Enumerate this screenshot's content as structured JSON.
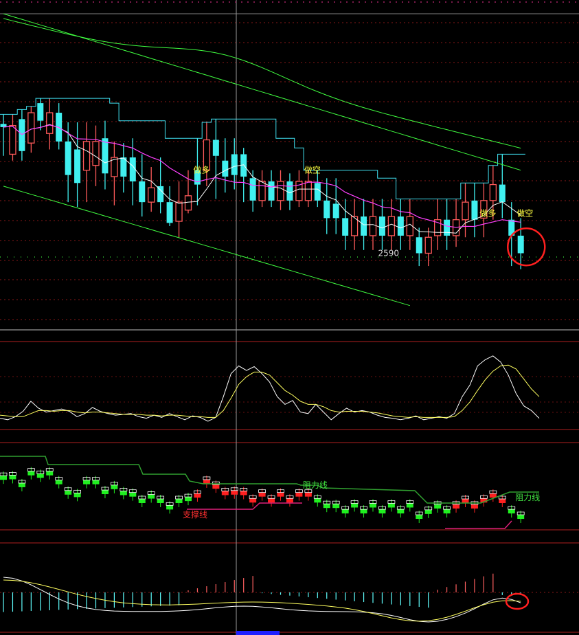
{
  "chart_data": [
    {
      "type": "candlestick",
      "panel": "main",
      "grid": true,
      "colors": {
        "up": "#ff5a5a",
        "down": "#40f0f0",
        "ma_fast": "#ffffff",
        "ma_mid": "#ff40ff",
        "ma_slow": "#40ff40",
        "channel": "#40e0f0"
      },
      "candles": [
        {
          "o": 2659,
          "c": 2657,
          "h": 2665,
          "l": 2639,
          "u": false
        },
        {
          "o": 2640,
          "c": 2658,
          "h": 2665,
          "l": 2636,
          "u": true
        },
        {
          "o": 2662,
          "c": 2642,
          "h": 2668,
          "l": 2636,
          "u": false
        },
        {
          "o": 2647,
          "c": 2666,
          "h": 2670,
          "l": 2641,
          "u": true
        },
        {
          "o": 2672,
          "c": 2661,
          "h": 2675,
          "l": 2655,
          "u": false
        },
        {
          "o": 2653,
          "c": 2666,
          "h": 2675,
          "l": 2643,
          "u": true
        },
        {
          "o": 2666,
          "c": 2648,
          "h": 2672,
          "l": 2643,
          "u": false
        },
        {
          "o": 2648,
          "c": 2627,
          "h": 2660,
          "l": 2610,
          "u": false
        },
        {
          "o": 2643,
          "c": 2622,
          "h": 2660,
          "l": 2607,
          "u": false
        },
        {
          "o": 2630,
          "c": 2648,
          "h": 2660,
          "l": 2610,
          "u": true
        },
        {
          "o": 2633,
          "c": 2648,
          "h": 2658,
          "l": 2620,
          "u": true
        },
        {
          "o": 2650,
          "c": 2628,
          "h": 2661,
          "l": 2618,
          "u": false
        },
        {
          "o": 2626,
          "c": 2638,
          "h": 2648,
          "l": 2608,
          "u": true
        },
        {
          "o": 2638,
          "c": 2626,
          "h": 2647,
          "l": 2616,
          "u": false
        },
        {
          "o": 2638,
          "c": 2623,
          "h": 2650,
          "l": 2608,
          "u": false
        },
        {
          "o": 2623,
          "c": 2610,
          "h": 2640,
          "l": 2601,
          "u": false
        },
        {
          "o": 2610,
          "c": 2619,
          "h": 2632,
          "l": 2604,
          "u": true
        },
        {
          "o": 2620,
          "c": 2610,
          "h": 2638,
          "l": 2603,
          "u": false
        },
        {
          "o": 2610,
          "c": 2597,
          "h": 2620,
          "l": 2595,
          "u": false
        },
        {
          "o": 2598,
          "c": 2610,
          "h": 2623,
          "l": 2588,
          "u": true
        },
        {
          "o": 2605,
          "c": 2614,
          "h": 2630,
          "l": 2603,
          "u": true
        },
        {
          "o": 2630,
          "c": 2621,
          "h": 2650,
          "l": 2608,
          "u": false
        },
        {
          "o": 2630,
          "c": 2649,
          "h": 2660,
          "l": 2620,
          "u": true
        },
        {
          "o": 2649,
          "c": 2639,
          "h": 2662,
          "l": 2612,
          "u": false
        },
        {
          "o": 2636,
          "c": 2626,
          "h": 2650,
          "l": 2616,
          "u": false
        },
        {
          "o": 2640,
          "c": 2627,
          "h": 2650,
          "l": 2618,
          "u": false
        },
        {
          "o": 2640,
          "c": 2626,
          "h": 2644,
          "l": 2610,
          "u": false
        },
        {
          "o": 2625,
          "c": 2611,
          "h": 2630,
          "l": 2604,
          "u": false
        },
        {
          "o": 2611,
          "c": 2623,
          "h": 2630,
          "l": 2607,
          "u": true
        },
        {
          "o": 2623,
          "c": 2611,
          "h": 2630,
          "l": 2607,
          "u": false
        },
        {
          "o": 2611,
          "c": 2623,
          "h": 2630,
          "l": 2605,
          "u": true
        },
        {
          "o": 2623,
          "c": 2611,
          "h": 2628,
          "l": 2605,
          "u": false
        },
        {
          "o": 2611,
          "c": 2623,
          "h": 2630,
          "l": 2607,
          "u": true
        },
        {
          "o": 2611,
          "c": 2623,
          "h": 2630,
          "l": 2607,
          "u": true
        },
        {
          "o": 2622,
          "c": 2611,
          "h": 2630,
          "l": 2607,
          "u": false
        },
        {
          "o": 2611,
          "c": 2600,
          "h": 2625,
          "l": 2590,
          "u": false
        },
        {
          "o": 2609,
          "c": 2600,
          "h": 2625,
          "l": 2590,
          "u": false
        },
        {
          "o": 2600,
          "c": 2589,
          "h": 2612,
          "l": 2580,
          "u": false
        },
        {
          "o": 2589,
          "c": 2601,
          "h": 2612,
          "l": 2580,
          "u": true
        },
        {
          "o": 2601,
          "c": 2589,
          "h": 2612,
          "l": 2580,
          "u": false
        },
        {
          "o": 2589,
          "c": 2601,
          "h": 2612,
          "l": 2580,
          "u": true
        },
        {
          "o": 2601,
          "c": 2589,
          "h": 2612,
          "l": 2580,
          "u": false
        },
        {
          "o": 2589,
          "c": 2601,
          "h": 2612,
          "l": 2580,
          "u": true
        },
        {
          "o": 2601,
          "c": 2589,
          "h": 2612,
          "l": 2580,
          "u": false
        },
        {
          "o": 2589,
          "c": 2601,
          "h": 2612,
          "l": 2580,
          "u": true
        },
        {
          "o": 2588,
          "c": 2578,
          "h": 2594,
          "l": 2570,
          "u": false
        },
        {
          "o": 2578,
          "c": 2588,
          "h": 2594,
          "l": 2570,
          "u": true
        },
        {
          "o": 2589,
          "c": 2599,
          "h": 2612,
          "l": 2580,
          "u": true
        },
        {
          "o": 2599,
          "c": 2589,
          "h": 2612,
          "l": 2580,
          "u": false
        },
        {
          "o": 2589,
          "c": 2599,
          "h": 2612,
          "l": 2582,
          "u": true
        },
        {
          "o": 2599,
          "c": 2610,
          "h": 2622,
          "l": 2588,
          "u": true
        },
        {
          "o": 2611,
          "c": 2599,
          "h": 2622,
          "l": 2588,
          "u": false
        },
        {
          "o": 2600,
          "c": 2611,
          "h": 2622,
          "l": 2588,
          "u": true
        },
        {
          "o": 2611,
          "c": 2621,
          "h": 2633,
          "l": 2599,
          "u": true
        },
        {
          "o": 2621,
          "c": 2610,
          "h": 2640,
          "l": 2600,
          "u": false
        },
        {
          "o": 2599,
          "c": 2589,
          "h": 2610,
          "l": 2570,
          "u": false
        },
        {
          "o": 2589,
          "c": 2578,
          "h": 2600,
          "l": 2568,
          "u": false
        }
      ],
      "annotations": [
        {
          "text": "做多",
          "i": 21,
          "y": 2630,
          "color": "#ffff40"
        },
        {
          "text": "做空",
          "i": 33,
          "y": 2630,
          "color": "#ffff40"
        },
        {
          "text": "做多",
          "i": 52,
          "y": 2603,
          "color": "#ffff40"
        },
        {
          "text": "做空",
          "i": 56,
          "y": 2603,
          "color": "#ffff40"
        },
        {
          "text": "2590",
          "i": 41,
          "y": 2578,
          "color": "#d8d8d8"
        }
      ],
      "highlight_circle": {
        "i": 56.6,
        "y": 2582,
        "color": "#ff2020"
      },
      "ylim": [
        2530,
        2728
      ]
    },
    {
      "type": "line",
      "panel": "oscillator",
      "series": [
        {
          "values": [
            12,
            10,
            14,
            21,
            34,
            25,
            20,
            22,
            24,
            21,
            14,
            18,
            26,
            21,
            18,
            16,
            17,
            18,
            14,
            12,
            16,
            13,
            18,
            14,
            10,
            15,
            13,
            8,
            13,
            40,
            70,
            80,
            74,
            79,
            70,
            59,
            40,
            30,
            35,
            20,
            18,
            30,
            20,
            10,
            18,
            25,
            20,
            22,
            20,
            16,
            13,
            12,
            10,
            12,
            15,
            10,
            12,
            14,
            12,
            18,
            40,
            55,
            80,
            88,
            93,
            85,
            68,
            44,
            28,
            22,
            12
          ],
          "color": "#ffffff"
        },
        {
          "values": [
            16,
            15,
            14,
            14,
            18,
            22,
            22,
            21,
            22,
            22,
            20,
            19,
            20,
            20,
            19,
            18,
            17,
            17,
            17,
            16,
            16,
            15,
            16,
            16,
            15,
            14,
            14,
            13,
            13,
            22,
            38,
            56,
            66,
            72,
            72,
            68,
            58,
            48,
            42,
            34,
            30,
            30,
            27,
            22,
            20,
            21,
            21,
            21,
            20,
            19,
            17,
            15,
            14,
            13,
            14,
            13,
            13,
            13,
            13,
            14,
            22,
            33,
            48,
            62,
            73,
            80,
            81,
            76,
            63,
            50,
            40
          ],
          "color": "#ffff60"
        }
      ],
      "ylim": [
        0,
        100
      ]
    },
    {
      "type": "box",
      "panel": "support_resistance",
      "colors": {
        "green": "#20f020",
        "red": "#ff2020",
        "outline": "#ffffff"
      },
      "labels": [
        {
          "text": "阻力线",
          "i": 33,
          "y": 1,
          "color": "#40e040"
        },
        {
          "text": "支撑线",
          "i": 20,
          "y": 0,
          "color": "#ff3030"
        },
        {
          "text": "阻力线",
          "i": 56,
          "y": 1,
          "color": "#40e040"
        }
      ]
    },
    {
      "type": "histogram",
      "panel": "macd",
      "colors": {
        "pos": "#ff6060",
        "neg": "#60ffff",
        "dif": "#ffffff",
        "dea": "#ffff60"
      }
    }
  ]
}
